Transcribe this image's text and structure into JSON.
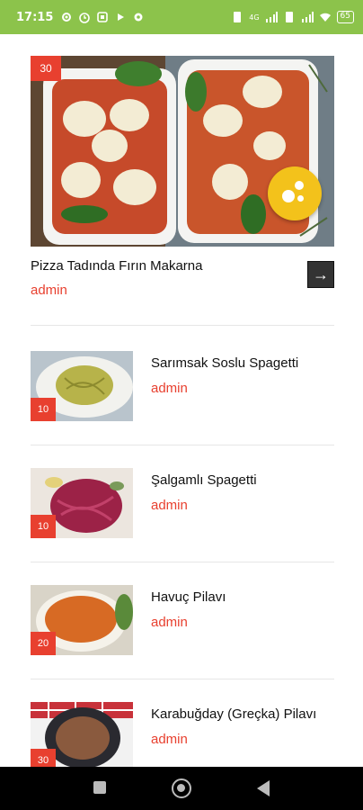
{
  "status_bar": {
    "time": "17:15",
    "network": "4G",
    "battery": "65"
  },
  "featured": {
    "badge": "30",
    "title": "Pizza Tadında Fırın Makarna",
    "author": "admin",
    "arrow": "→"
  },
  "items": [
    {
      "badge": "10",
      "title": "Sarımsak Soslu Spagetti",
      "author": "admin"
    },
    {
      "badge": "10",
      "title": "Şalgamlı Spagetti",
      "author": "admin"
    },
    {
      "badge": "20",
      "title": "Havuç Pilavı",
      "author": "admin"
    },
    {
      "badge": "30",
      "title": "Karabuğday (Greçka) Pilavı",
      "author": "admin"
    }
  ],
  "colors": {
    "status_bar": "#8cc34b",
    "accent_red": "#e8402f",
    "fab_yellow": "#f3c21b"
  }
}
